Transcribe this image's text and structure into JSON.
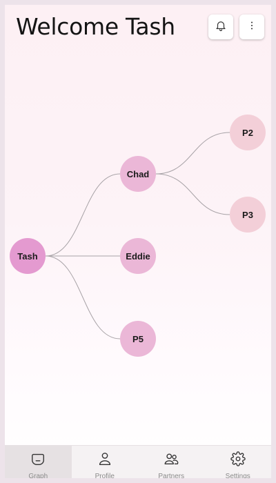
{
  "header": {
    "title": "Welcome Tash",
    "actions": [
      {
        "icon": "bell-icon",
        "label": "Notifications"
      },
      {
        "icon": "more-vertical-icon",
        "label": "More"
      }
    ]
  },
  "graph": {
    "nodes": [
      {
        "id": "tash",
        "label": "Tash",
        "level": "root"
      },
      {
        "id": "chad",
        "label": "Chad",
        "level": "mid"
      },
      {
        "id": "eddie",
        "label": "Eddie",
        "level": "mid"
      },
      {
        "id": "p5",
        "label": "P5",
        "level": "mid"
      },
      {
        "id": "p2",
        "label": "P2",
        "level": "leaf"
      },
      {
        "id": "p3",
        "label": "P3",
        "level": "leaf"
      }
    ],
    "edges": [
      [
        "tash",
        "chad"
      ],
      [
        "tash",
        "eddie"
      ],
      [
        "tash",
        "p5"
      ],
      [
        "chad",
        "p2"
      ],
      [
        "chad",
        "p3"
      ]
    ],
    "colors": {
      "root": "#e49ad0",
      "mid": "#ebb7d7",
      "leaf": "#f3cfd8",
      "edge": "#a7a2a6"
    }
  },
  "nav": {
    "items": [
      {
        "label": "Graph",
        "icon": "graph-face-icon",
        "active": true
      },
      {
        "label": "Profile",
        "icon": "person-icon",
        "active": false
      },
      {
        "label": "Partners",
        "icon": "partners-icon",
        "active": false
      },
      {
        "label": "Settings",
        "icon": "gear-icon",
        "active": false
      }
    ]
  }
}
